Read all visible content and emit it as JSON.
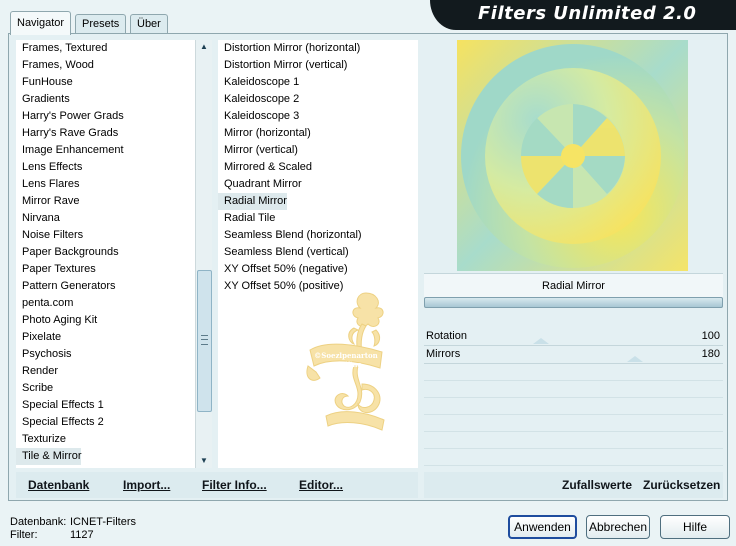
{
  "app_title": "Filters Unlimited 2.0",
  "tabs": [
    {
      "label": "Navigator",
      "active": true
    },
    {
      "label": "Presets",
      "active": false
    },
    {
      "label": "Über",
      "active": false
    }
  ],
  "categories": {
    "items": [
      "Frames, Textured",
      "Frames, Wood",
      "FunHouse",
      "Gradients",
      "Harry's Power Grads",
      "Harry's Rave Grads",
      "Image Enhancement",
      "Lens Effects",
      "Lens Flares",
      "Mirror Rave",
      "Nirvana",
      "Noise Filters",
      "Paper Backgrounds",
      "Paper Textures",
      "Pattern Generators",
      "penta.com",
      "Photo Aging Kit",
      "Pixelate",
      "Psychosis",
      "Render",
      "Scribe",
      "Special Effects 1",
      "Special Effects 2",
      "Texturize",
      "Tile & Mirror"
    ],
    "selected": "Tile & Mirror"
  },
  "filters": {
    "items": [
      "Distortion Mirror (horizontal)",
      "Distortion Mirror (vertical)",
      "Kaleidoscope 1",
      "Kaleidoscope 2",
      "Kaleidoscope 3",
      "Mirror (horizontal)",
      "Mirror (vertical)",
      "Mirrored & Scaled",
      "Quadrant Mirror",
      "Radial Mirror",
      "Radial Tile",
      "Seamless Blend (horizontal)",
      "Seamless Blend (vertical)",
      "XY Offset 50% (negative)",
      "XY Offset 50% (positive)"
    ],
    "selected": "Radial Mirror"
  },
  "bottom_left": {
    "datenbank": "Datenbank",
    "import": "Import...",
    "filter_info": "Filter Info...",
    "editor": "Editor..."
  },
  "bottom_right": {
    "zufallswerte": "Zufallswerte",
    "zuruecksetzen": "Zurücksetzen"
  },
  "parameters": {
    "title": "Radial Mirror",
    "progress": 1.0,
    "rows": [
      {
        "label": "Rotation",
        "value": "100"
      },
      {
        "label": "Mirrors",
        "value": "180"
      }
    ]
  },
  "status": {
    "datenbank_label": "Datenbank:",
    "datenbank_value": "ICNET-Filters",
    "filter_label": "Filter:",
    "filter_value": "1127"
  },
  "buttons": {
    "apply": "Anwenden",
    "cancel": "Abbrechen",
    "help": "Hilfe"
  },
  "watermark_text": [
    "©Soezlpenarton",
    "Wina"
  ],
  "colors": {
    "preview_yellow": "#f6e15a",
    "preview_teal": "#9fd8c8",
    "banner": "#121a1e",
    "watermark": "#f5d98a"
  }
}
